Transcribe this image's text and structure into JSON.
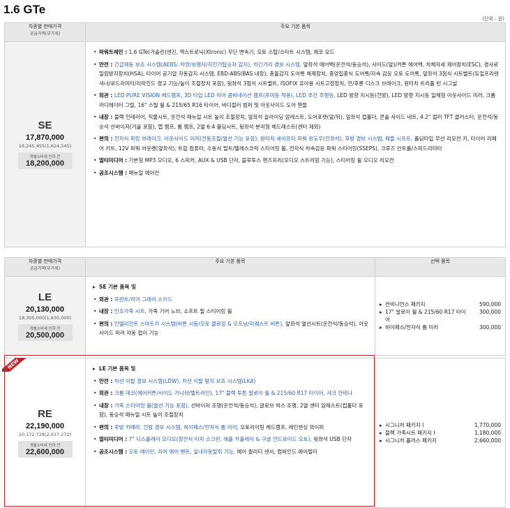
{
  "title": "1.6 GTe",
  "unit": "(단위 : 원)",
  "headers": {
    "price_label": "차종별 판매가격",
    "price_sub": "공급가액(부가세)",
    "features_label": "주요 기본 품목",
    "options_label": "선택 품목"
  },
  "trims": {
    "se": {
      "name": "SE",
      "price": "17,870,000",
      "supply": "16,245,455(1,624,545)",
      "tax_label": "개별소비세 인하 전",
      "tax_price": "18,200,000",
      "features": [
        {
          "head": "파워트레인 :",
          "text": "1.6 GTe(가솔린)엔진, 엑스트로닉(Xtronic) 무단 변속기, 오토 스탑/스타트 시스템, 에코 모드"
        },
        {
          "head": "안전 :",
          "blue": "긴급제동 보조 시스템(AEBS: 차량/보행자/자전거탑승자 감지), 차간거리 경보 시스템,",
          "text": "앞좌석 에어백(운전석/동승석), 사이드(앞)/커튼 에어백, 차체자세 제어장치(ESC), 경사로 밀림방지장치(HSA), 타이어 공기압 자동감지 시스템, EBD-ABS(BAS 내장), 충돌감지 도어록 해제장치, 중앙집중식 도어록/자속 감응 오토 도어록, 앞좌석 3점식 시트벨트(듀얼프리텐셔너/로드리미터/리마인드 경고 기능/높이 조절장치 포함), 뒷좌석 3점식 시트벨트, ISOFIX 유아용 시트고정장치, 전/후륜 디스크 브레이크, 원터치 트리플 턴 시그널"
        },
        {
          "head": "외관 :",
          "blue": "LED PURE VISION 헤드램프, 3D 타입 LED 리어 콤비네이션 램프(후미등 적용), LED 주간 주행등,",
          "text": "LED 방향 지시등(전방), LED 방향 지시등 일체형 아웃사이드 미러, 크롬 라디에이터 그릴, 16\" 스틸 휠 & 215/65 R16 타이어, 바디컬러 범퍼 및 아웃사이드 도어 핸들"
        },
        {
          "head": "내장 :",
          "blue": "",
          "text": "블랙 인테리어, 직물시트, 운전석 매뉴얼 시트 높이 조절장치, 앞좌석 슬라이딩 암레스트, 도어포켓(앞/뒤), 앞좌석 컵홀더, 콘솔 사이드 네트, 4.2\" 컬러 TFT 클러스터, 운전석/동승석 선바이저(거울 포함), 맵 램프, 룸 램프, 2열 6:4 폴딩시트, 뒷좌석 분리형 헤드레스트(센터 제외)"
        },
        {
          "head": "편의 :",
          "blue": "전자식 파킹 브레이크, 아웃사이드 미러(전동조절/열선 기능 포함), 원터치 세이프티 파워 윈도우(전좌석), 후방 경보 시스템, 패들 시프트,",
          "text": "폴딩타입 무선 리모컨 키, 타이어 리페어 키트, 12V 파워 아웃렛(앞좌석), 트립 컴퓨터, 수동식 틸트/텔레스코픽 스티어링 휠, 전자식 차속감응 파워 스티어링(SSEPS), 크루즈 컨트롤/스피드리미터"
        },
        {
          "head": "멀티미디어 :",
          "blue": "",
          "text": "기본형 MP3 오디오, 6 스피커, AUX & USB 단자, 블루투스 핸즈프리(오디오 스트리밍 기능), 스티어링 휠 오디오 리모컨"
        },
        {
          "head": "공조시스템 :",
          "blue": "",
          "text": "매뉴얼 에어컨"
        }
      ]
    },
    "le": {
      "name": "LE",
      "price": "20,130,000",
      "supply": "18,300,000(1,830,000)",
      "tax_label": "개별소비세 인하 전",
      "tax_price": "20,500,000",
      "include": "SE 기본 품목 및",
      "features": [
        {
          "head": "외관 :",
          "blue": "프런트/리어 그레이 스키드",
          "text": ""
        },
        {
          "head": "내장 :",
          "blue": "인조가죽 시트,",
          "text": "가죽 기어 노브, 소프트 필 스티어링 휠"
        },
        {
          "head": "편의 :",
          "blue": "인텔리전트 스마트키 시스템(버튼 시동/오토 클로징 & 오프닝/리퀘스트 버튼),",
          "text": "앞좌석 열선시트(운전석/동승석), 아웃사이드 미러 자동 접이 기능"
        }
      ],
      "options": [
        {
          "name": "컨비니언스 패키지",
          "price": "590,000"
        },
        {
          "name": "17\" 알로이 휠 & 215/60 R17 타이어",
          "price": "300,000"
        },
        {
          "name": "하이패스/전자식 룸 미러",
          "price": "300,000"
        }
      ]
    },
    "re": {
      "badge": "NEW",
      "name": "RE",
      "price": "22,190,000",
      "supply": "20,172,728(2,017,272)",
      "tax_label": "개별소비세 인하 전",
      "tax_price": "22,600,000",
      "include": "LE 기본 품목 및",
      "features": [
        {
          "head": "안전 :",
          "blue": "차선 이탈 경보 시스템(LDW), 차선 이탈 방지 보조 시스템(LKA)",
          "text": ""
        },
        {
          "head": "외관 :",
          "blue": "크롬 데코(에어커튼/사이드 가니쉬/벨트라인), 17\" 블랙 투톤 알로이 휠 & 215/60 R17 타이어, 샤크 안테나",
          "text": ""
        },
        {
          "head": "내장 :",
          "blue": "가죽 스티어링 휠(열선 기능 포함),",
          "text": "선바이저 조명(운전석/동승석), 글로브 박스 조명, 2열 센터 암레스트(컵홀더 포함), 동승석 매뉴얼 시트 높이 조절장치"
        },
        {
          "head": "편의 :",
          "blue": "후방 카메라, 전방 경보 시스템, 하이패스/전자식 룸 미러,",
          "text": "오토라이팅 헤드램프, 레인센싱 와이퍼"
        },
        {
          "head": "멀티미디어 :",
          "blue": "7\" 디스플레이 오디오(정전식 터치 스크린, 애플 카플레이 & 구글 안드로이드 오토),",
          "text": "뒷좌석 USB 단자"
        },
        {
          "head": "공조시스템 :",
          "blue": "오토 에어컨, 리어 에어 벤트, 실내자동탈취 기능,",
          "text": "에어 퀄리티 센서, 컴바인드 에어필터"
        }
      ],
      "options": [
        {
          "name": "시그니처 패키지 I",
          "price": "1,770,000"
        },
        {
          "name": "블랙 가죽시트 패키지 I",
          "price": "1,180,000"
        },
        {
          "name": "시그니처 플러스 패키지",
          "price": "2,660,000"
        }
      ]
    }
  }
}
